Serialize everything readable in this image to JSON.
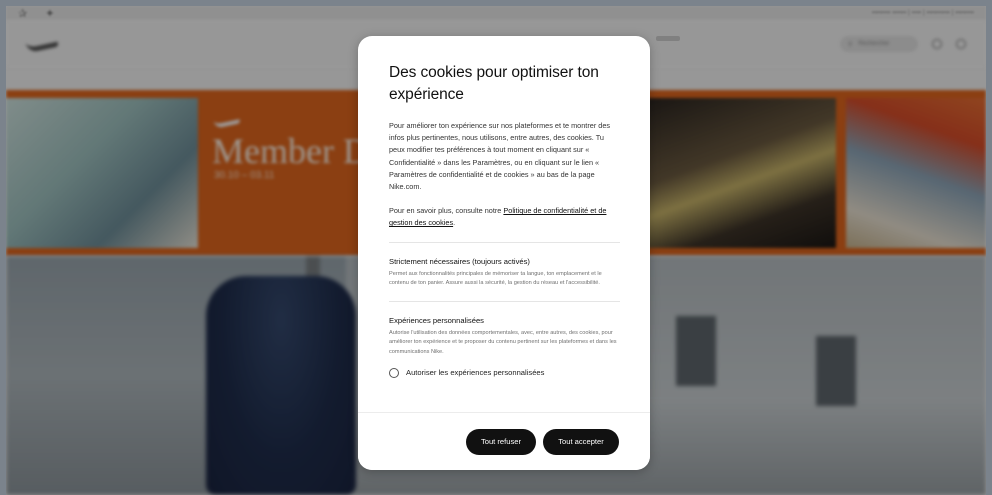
{
  "background_page": {
    "banner": {
      "title": "Member D",
      "dates": "30.10 – 03.11"
    },
    "search_placeholder": "Rechercher"
  },
  "modal": {
    "title": "Des cookies pour optimiser ton expérience",
    "intro": "Pour améliorer ton expérience sur nos plateformes et te montrer des infos plus pertinentes, nous utilisons, entre autres, des cookies. Tu peux modifier tes préférences à tout moment en cliquant sur « Confidentialité » dans les Paramètres, ou en cliquant sur le lien « Paramètres de confidentialité et de cookies » au bas de la page Nike.com.",
    "more_prefix": "Pour en savoir plus, consulte notre ",
    "more_link": "Politique de confidentialité et de gestion des cookies",
    "more_suffix": ".",
    "sections": {
      "necessary": {
        "title": "Strictement nécessaires (toujours activés)",
        "description": "Permet aux fonctionnalités principales de mémoriser ta langue, ton emplacement et le contenu de ton panier. Assure aussi la sécurité, la gestion du réseau et l'accessibilité."
      },
      "personalized": {
        "title": "Expériences personnalisées",
        "description": "Autorise l'utilisation des données comportementales, avec, entre autres, des cookies, pour améliorer ton expérience et te proposer du contenu pertinent sur les plateformes et dans les communications Nike.",
        "radio_label": "Autoriser les expériences personnalisées",
        "radio_checked": false
      }
    },
    "buttons": {
      "refuse": "Tout refuser",
      "accept": "Tout accepter"
    }
  }
}
